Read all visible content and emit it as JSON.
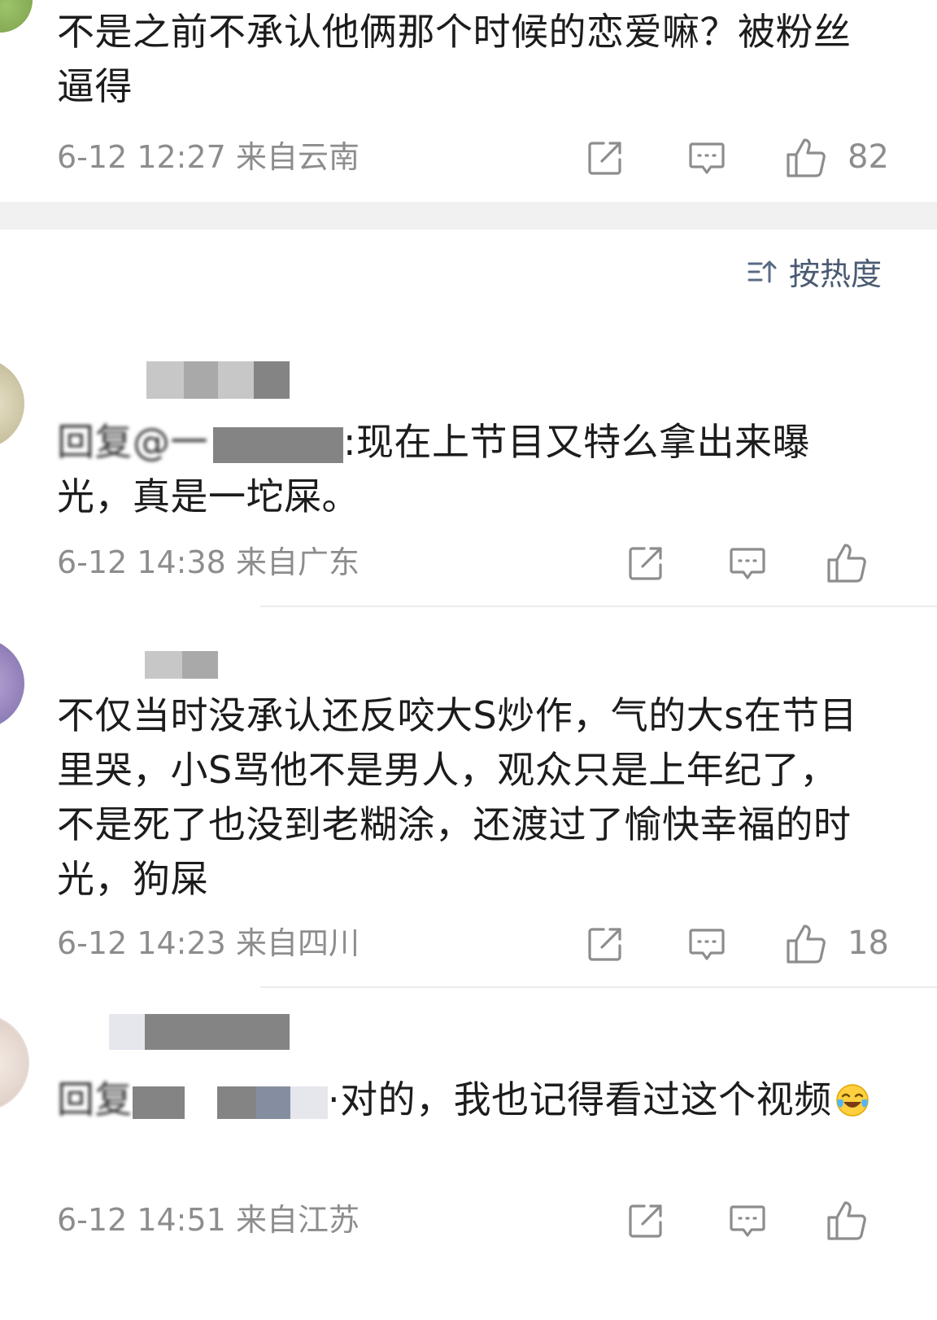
{
  "comments": [
    {
      "text": "不是之前不承认他俩那个时候的恋爱嘛？被粉丝逼得",
      "time": "6-12 12:27",
      "location": "来自云南",
      "likes": "82"
    },
    {
      "reply_prefix": "回复@一",
      "text": ":现在上节目又特么拿出来曝光，真是一坨屎。",
      "time": "6-12 14:38",
      "location": "来自广东",
      "likes": ""
    },
    {
      "text": "不仅当时没承认还反咬大S炒作，气的大s在节目里哭，小S骂他不是男人，观众只是上年纪了，不是死了也没到老糊涂，还渡过了愉快幸福的时光，狗屎",
      "time": "6-12 14:23",
      "location": "来自四川",
      "likes": "18"
    },
    {
      "reply_prefix": "回复",
      "text": "·对的，我也记得看过这个视频",
      "emoji": "laughing-crying-emoji",
      "time": "6-12 14:51",
      "location": "来自江苏",
      "likes": ""
    }
  ],
  "sort": {
    "label": "按热度",
    "icon": "sort-icon"
  },
  "icons": {
    "share": "share-icon",
    "comment": "comment-icon",
    "like": "thumbs-up-icon"
  },
  "colors": {
    "text": "#1c1c1c",
    "meta": "#8d8d8d",
    "separator": "#f1f1f1"
  }
}
